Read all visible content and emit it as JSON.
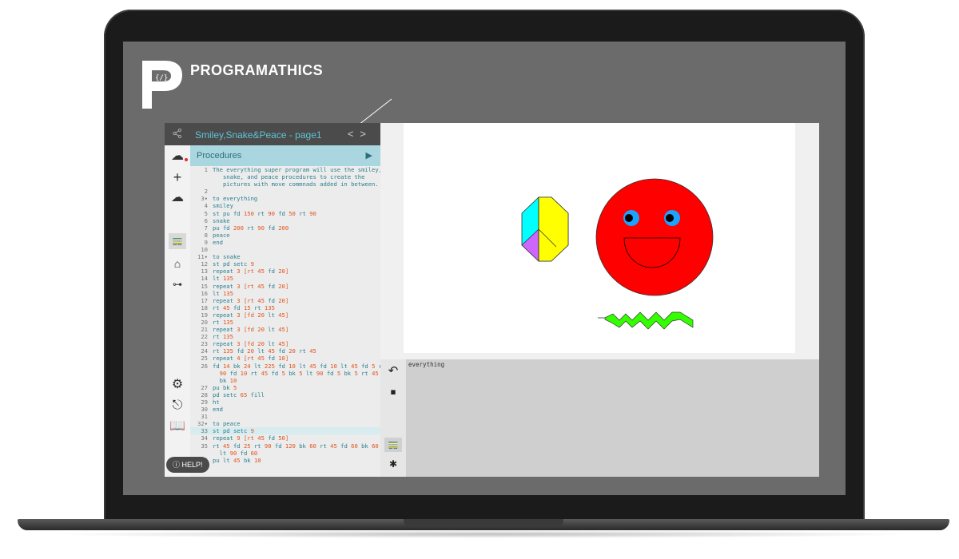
{
  "brand": {
    "name": "PROGRAMATHICS"
  },
  "app": {
    "title": "Smiley,Snake&Peace - page1",
    "procedures_label": "Procedures",
    "help_label": "HELP!",
    "console_text": "everything"
  },
  "code_lines": [
    {
      "n": "1",
      "t": "The everything super program will use the smiley,"
    },
    {
      "n": "",
      "t": "   snake, and peace procedures to create the"
    },
    {
      "n": "",
      "t": "   pictures with move commnads added in between."
    },
    {
      "n": "2",
      "t": ""
    },
    {
      "n": "3▾",
      "t": "to everything"
    },
    {
      "n": "4",
      "t": "smiley"
    },
    {
      "n": "5",
      "t": "st pu fd 150 rt 90 fd 50 rt 90"
    },
    {
      "n": "6",
      "t": "snake"
    },
    {
      "n": "7",
      "t": "pu fd 200 rt 90 fd 200"
    },
    {
      "n": "8",
      "t": "peace"
    },
    {
      "n": "9",
      "t": "end"
    },
    {
      "n": "10",
      "t": ""
    },
    {
      "n": "11▾",
      "t": "to snake"
    },
    {
      "n": "12",
      "t": "st pd setc 9"
    },
    {
      "n": "13",
      "t": "repeat 3 [rt 45 fd 20]"
    },
    {
      "n": "14",
      "t": "lt 135"
    },
    {
      "n": "15",
      "t": "repeat 3 [rt 45 fd 20]"
    },
    {
      "n": "16",
      "t": "lt 135"
    },
    {
      "n": "17",
      "t": "repeat 3 [rt 45 fd 20]"
    },
    {
      "n": "18",
      "t": "rt 45 fd 15 rt 135"
    },
    {
      "n": "19",
      "t": "repeat 3 [fd 20 lt 45]"
    },
    {
      "n": "20",
      "t": "rt 135"
    },
    {
      "n": "21",
      "t": "repeat 3 [fd 20 lt 45]"
    },
    {
      "n": "22",
      "t": "rt 135"
    },
    {
      "n": "23",
      "t": "repeat 3 [fd 20 lt 45]"
    },
    {
      "n": "24",
      "t": "rt 135 fd 20 lt 45 fd 20 rt 45"
    },
    {
      "n": "25",
      "t": "repeat 4 [rt 45 fd 10]"
    },
    {
      "n": "26",
      "t": "fd 14 bk 24 lt 225 fd 10 lt 45 fd 10 lt 45 fd 5 rt"
    },
    {
      "n": "",
      "t": "  90 fd 10 rt 45 fd 5 bk 5 lt 90 fd 5 bk 5 rt 45"
    },
    {
      "n": "",
      "t": "  bk 10"
    },
    {
      "n": "27",
      "t": "pu bk 5"
    },
    {
      "n": "28",
      "t": "pd setc 65 fill"
    },
    {
      "n": "29",
      "t": "ht"
    },
    {
      "n": "30",
      "t": "end"
    },
    {
      "n": "31",
      "t": ""
    },
    {
      "n": "32▾",
      "t": "to peace"
    },
    {
      "n": "33",
      "t": "st pd setc 9"
    },
    {
      "n": "34",
      "t": "repeat 9 [rt 45 fd 50]"
    },
    {
      "n": "35",
      "t": "rt 45 fd 25 rt 90 fd 120 bk 60 rt 45 fd 60 bk 60"
    },
    {
      "n": "",
      "t": "  lt 90 fd 60"
    },
    {
      "n": "36",
      "t": "pu lt 45 bk 10"
    }
  ],
  "colors": {
    "accent": "#5fc4d6",
    "smiley": "#ff0000",
    "octagon_cyan": "#00ffff",
    "octagon_yellow": "#ffff00",
    "octagon_purple": "#cc66ff",
    "snake": "#33ff00"
  }
}
